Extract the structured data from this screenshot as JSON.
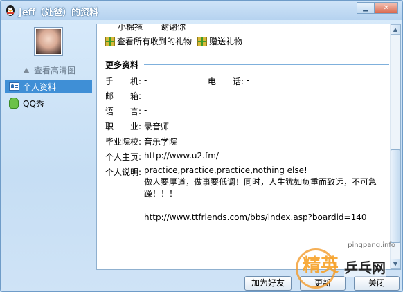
{
  "window": {
    "title": "Jeff（处爸）的资料",
    "min_label": "▁",
    "close_label": "✕"
  },
  "sidebar": {
    "view_hd_label": "查看高清图",
    "items": [
      {
        "label": "个人资料",
        "active": true,
        "icon": "profile-card-icon"
      },
      {
        "label": "QQ秀",
        "active": false,
        "icon": "qq-show-icon"
      }
    ]
  },
  "content": {
    "gifts": [
      "小棉拖",
      "谢谢你"
    ],
    "links": [
      "查看所有收到的礼物",
      "赠送礼物"
    ],
    "section_title": "更多资料",
    "fields": {
      "mobile": {
        "label": "手　　机:",
        "value": "-"
      },
      "phone": {
        "label": "电　　话:",
        "value": "-"
      },
      "email": {
        "label": "邮　　箱:",
        "value": "-"
      },
      "language": {
        "label": "语　　言:",
        "value": "-"
      },
      "job": {
        "label": "职　　业:",
        "value": "录音师"
      },
      "school": {
        "label": "毕业院校:",
        "value": "音乐学院"
      },
      "homepage": {
        "label": "个人主页:",
        "value": "http://www.u2.fm/"
      },
      "about": {
        "label": "个人说明:"
      }
    },
    "about_lines": [
      "practice,practice,practice,nothing else!",
      "做人要厚道，做事要低调！同时，人生犹如负重而致远，不可急躁！！！",
      "",
      "http://www.ttfriends.com/bbs/index.asp?boardid=140"
    ]
  },
  "buttons": {
    "add_friend": "加为好友",
    "update": "更新",
    "close": "关闭"
  },
  "watermark": {
    "url": "pingpang.info",
    "brand_left": "精英",
    "brand_right": "乒乓网"
  }
}
